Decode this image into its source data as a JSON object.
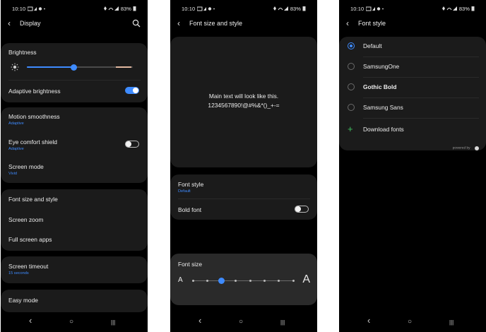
{
  "status": {
    "time": "10:10",
    "battery": "83%"
  },
  "screen1": {
    "title": "Display",
    "brightness_label": "Brightness",
    "brightness_level": 0.44,
    "adaptive_brightness": {
      "label": "Adaptive brightness",
      "on": true
    },
    "motion_smoothness": {
      "label": "Motion smoothness",
      "value": "Adaptive"
    },
    "eye_comfort": {
      "label": "Eye comfort shield",
      "value": "Adaptive",
      "on": false
    },
    "screen_mode": {
      "label": "Screen mode",
      "value": "Vivid"
    },
    "font_size_style": "Font size and style",
    "screen_zoom": "Screen zoom",
    "full_screen_apps": "Full screen apps",
    "screen_timeout": {
      "label": "Screen timeout",
      "value": "15 seconds"
    },
    "easy_mode": "Easy mode"
  },
  "screen2": {
    "title": "Font size and style",
    "preview_line1": "Main text will look like this.",
    "preview_line2": "1234567890!@#%&*()_+-=",
    "font_style": {
      "label": "Font style",
      "value": "Default"
    },
    "bold_font": {
      "label": "Bold font",
      "on": false
    },
    "font_size_label": "Font size",
    "font_size_small_glyph": "A",
    "font_size_large_glyph": "A",
    "font_size_steps": 8,
    "font_size_selected_step": 2
  },
  "screen3": {
    "title": "Font style",
    "options": [
      {
        "label": "Default",
        "selected": true
      },
      {
        "label": "SamsungOne",
        "selected": false
      },
      {
        "label": "Gothic Bold",
        "selected": false
      },
      {
        "label": "Samsung Sans",
        "selected": false
      }
    ],
    "download_label": "Download fonts",
    "powered_by": "powered by"
  },
  "nav": {
    "back": "‹",
    "home": "○",
    "recents": "|||"
  },
  "colors": {
    "accent": "#3e8bff",
    "background": "#000000",
    "card": "#1b1b1b"
  }
}
